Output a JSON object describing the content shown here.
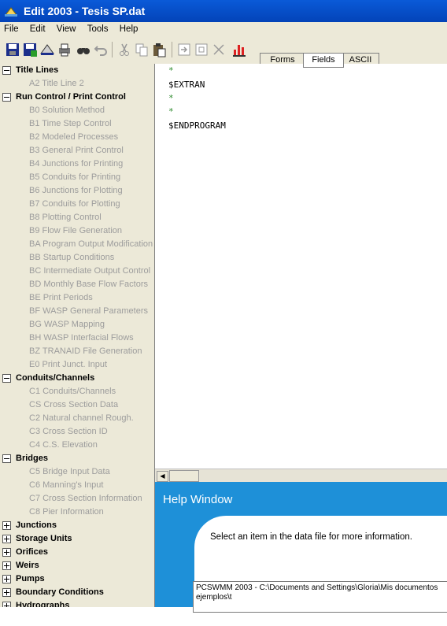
{
  "window": {
    "title": "Edit 2003 - Tesis SP.dat",
    "titlebar_color": "#0a5ad8"
  },
  "menu": [
    "File",
    "Edit",
    "View",
    "Tools",
    "Help"
  ],
  "toolbar": {
    "icons": [
      "save-disk-icon",
      "save-as-icon",
      "open-icon",
      "print-icon",
      "find-icon",
      "undo-icon",
      "cut-icon",
      "copy-icon",
      "paste-icon",
      "import-icon",
      "export-icon",
      "delete-icon",
      "chart-icon"
    ],
    "tabs": [
      "Forms",
      "Fields",
      "ASCII"
    ],
    "active_tab": "Fields"
  },
  "tree": [
    {
      "type": "head",
      "exp": "minus",
      "label": "Title Lines"
    },
    {
      "type": "child",
      "label": "A2 Title Line 2"
    },
    {
      "type": "head",
      "exp": "minus",
      "label": "Run Control / Print Control"
    },
    {
      "type": "child",
      "label": "B0 Solution Method"
    },
    {
      "type": "child",
      "label": "B1 Time Step Control"
    },
    {
      "type": "child",
      "label": "B2 Modeled Processes"
    },
    {
      "type": "child",
      "label": "B3 General Print Control"
    },
    {
      "type": "child",
      "label": "B4 Junctions for Printing"
    },
    {
      "type": "child",
      "label": "B5 Conduits for Printing"
    },
    {
      "type": "child",
      "label": "B6 Junctions for Plotting"
    },
    {
      "type": "child",
      "label": "B7 Conduits for Plotting"
    },
    {
      "type": "child",
      "label": "B8 Plotting Control"
    },
    {
      "type": "child",
      "label": "B9 Flow File Generation"
    },
    {
      "type": "child",
      "label": "BA Program Output Modification"
    },
    {
      "type": "child",
      "label": "BB Startup Conditions"
    },
    {
      "type": "child",
      "label": "BC Intermediate Output Control"
    },
    {
      "type": "child",
      "label": "BD Monthly Base Flow Factors"
    },
    {
      "type": "child",
      "label": "BE Print Periods"
    },
    {
      "type": "child",
      "label": "BF WASP General Parameters"
    },
    {
      "type": "child",
      "label": "BG WASP Mapping"
    },
    {
      "type": "child",
      "label": "BH WASP Interfacial Flows"
    },
    {
      "type": "child",
      "label": "BZ TRANAID File Generation"
    },
    {
      "type": "child",
      "label": "E0 Print Junct. Input"
    },
    {
      "type": "head",
      "exp": "minus",
      "label": "Conduits/Channels"
    },
    {
      "type": "child",
      "label": "C1 Conduits/Channels"
    },
    {
      "type": "child",
      "label": "CS Cross Section Data"
    },
    {
      "type": "child",
      "label": "C2 Natural channel Rough."
    },
    {
      "type": "child",
      "label": "C3 Cross Section ID"
    },
    {
      "type": "child",
      "label": "C4 C.S. Elevation"
    },
    {
      "type": "head",
      "exp": "minus",
      "label": "Bridges"
    },
    {
      "type": "child",
      "label": "C5 Bridge Input Data"
    },
    {
      "type": "child",
      "label": "C6 Manning's Input"
    },
    {
      "type": "child",
      "label": "C7 Cross Section Information"
    },
    {
      "type": "child",
      "label": "C8 Pier Information"
    },
    {
      "type": "head",
      "exp": "plus",
      "label": "Junctions"
    },
    {
      "type": "head",
      "exp": "plus",
      "label": "Storage Units"
    },
    {
      "type": "head",
      "exp": "plus",
      "label": "Orifices"
    },
    {
      "type": "head",
      "exp": "plus",
      "label": "Weirs"
    },
    {
      "type": "head",
      "exp": "plus",
      "label": "Pumps"
    },
    {
      "type": "head",
      "exp": "plus",
      "label": "Boundary Conditions"
    },
    {
      "type": "head",
      "exp": "plus",
      "label": "Hydrographs"
    }
  ],
  "editor": {
    "lines": [
      "*",
      "$EXTRAN",
      "*",
      "*",
      "$ENDPROGRAM"
    ],
    "star_color": "#2e8b2e"
  },
  "help": {
    "title": "Help Window",
    "message": "Select an item in the data file for more information.",
    "status": "PCSWMM 2003 - C:\\Documents and Settings\\Gloria\\Mis documentos\nejemplos\\t",
    "bg_color": "#1e90d8"
  }
}
